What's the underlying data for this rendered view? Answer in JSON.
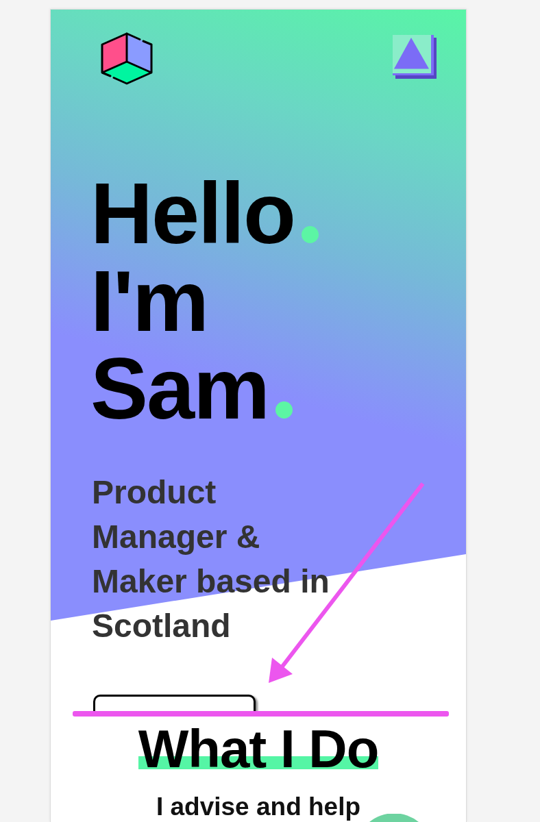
{
  "hero": {
    "greeting": [
      {
        "text": "Hello",
        "dot": true
      },
      {
        "text": "I'm",
        "dot": false
      },
      {
        "text": "Sam",
        "dot": true
      }
    ],
    "tagline": "Product Manager & Maker based in Scotland"
  },
  "what_i_do": {
    "heading": "What I Do",
    "intro": "I advise and help"
  }
}
